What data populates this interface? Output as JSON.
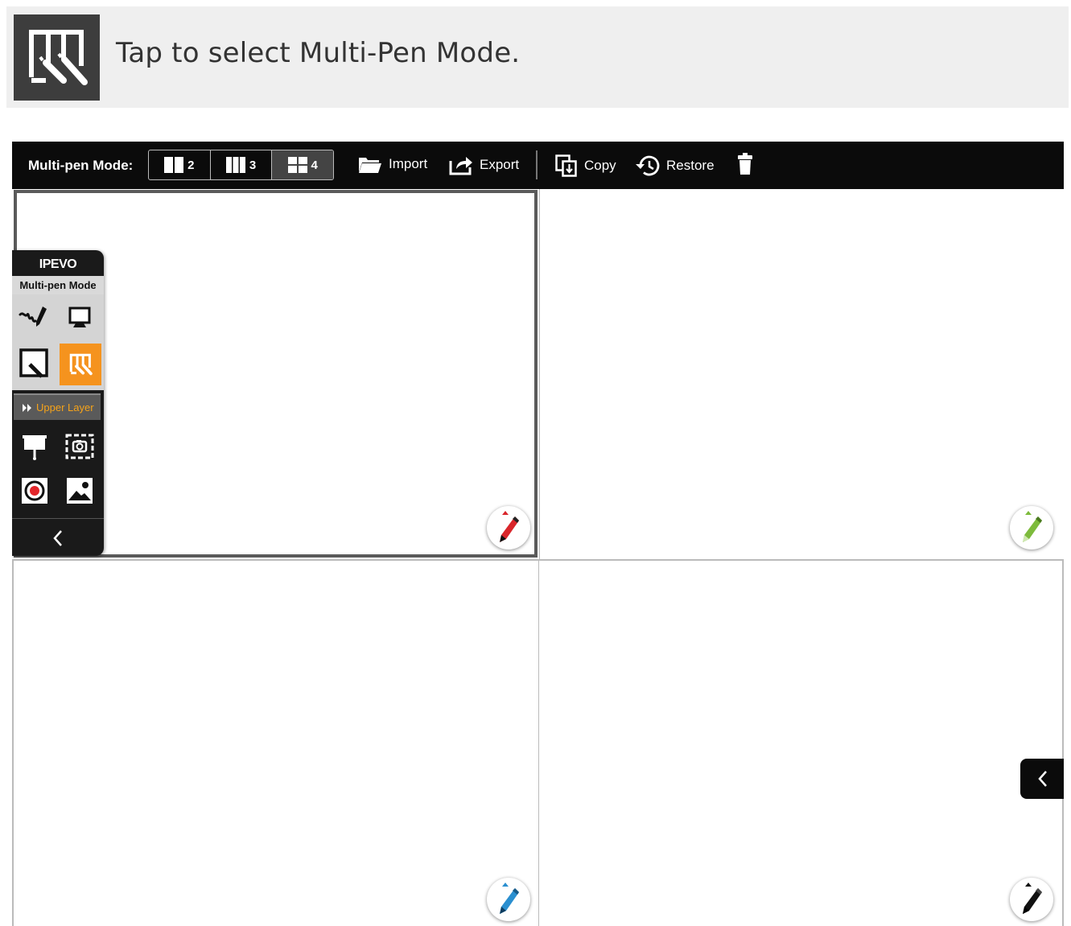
{
  "banner": {
    "icon": "multi-pen-mode-icon",
    "text": "Tap to select Multi-Pen Mode."
  },
  "toolbar": {
    "mode_label": "Multi-pen Mode:",
    "split_options": [
      {
        "label": "2",
        "icon": "two-column-icon",
        "active": false
      },
      {
        "label": "3",
        "icon": "three-column-icon",
        "active": false
      },
      {
        "label": "4",
        "icon": "four-grid-icon",
        "active": true
      }
    ],
    "import_label": "Import",
    "export_label": "Export",
    "copy_label": "Copy",
    "restore_label": "Restore",
    "delete_icon": "trash-icon"
  },
  "side_panel": {
    "brand": "IPEVO",
    "mode": "Multi-pen Mode",
    "upper_layer": "Upper Layer",
    "accent": "#f5931e"
  },
  "pens": [
    {
      "pane": "top-left",
      "color": "#d9262b"
    },
    {
      "pane": "top-right",
      "color": "#7dbb3c"
    },
    {
      "pane": "bottom-left",
      "color": "#2a8fd0"
    },
    {
      "pane": "bottom-right",
      "color": "#111111"
    }
  ]
}
